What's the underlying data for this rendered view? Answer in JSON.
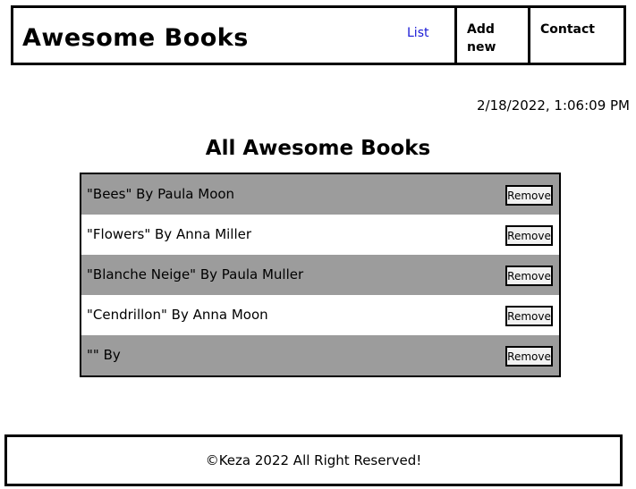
{
  "header": {
    "logo": "Awesome Books",
    "nav": {
      "list": "List",
      "add_new": "Add new",
      "contact": "Contact"
    }
  },
  "datetime": "2/18/2022, 1:06:09 PM",
  "main": {
    "title": "All Awesome Books",
    "books": [
      {
        "text": "\"Bees\" By Paula Moon",
        "button": "Remove"
      },
      {
        "text": "\"Flowers\" By Anna Miller",
        "button": "Remove"
      },
      {
        "text": "\"Blanche Neige\" By Paula Muller",
        "button": "Remove"
      },
      {
        "text": "\"Cendrillon\" By Anna Moon",
        "button": "Remove"
      },
      {
        "text": "\"\" By",
        "button": "Remove"
      }
    ]
  },
  "footer": {
    "text": "©Keza 2022 All Right Reserved!"
  },
  "colors": {
    "shaded_row": "#9c9c9c",
    "nav_link": "#1a1ad6"
  }
}
